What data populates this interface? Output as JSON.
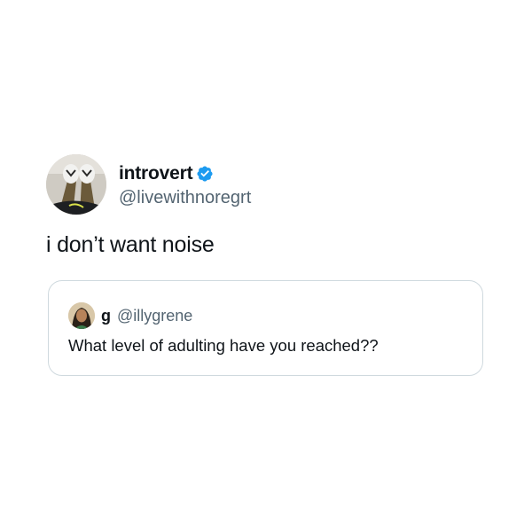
{
  "tweet": {
    "author": {
      "display_name": "introvert",
      "handle": "@livewithnoregrt",
      "verified": true,
      "avatar_icon": "avatar-photo-feet-icon"
    },
    "text": "i don’t want noise",
    "quoted_tweet": {
      "display_name": "g",
      "handle": "@illygrene",
      "avatar_icon": "avatar-photo-person-icon",
      "text": "What level of adulting have you reached??"
    }
  },
  "colors": {
    "background": "#ffffff",
    "text_primary": "#0f1419",
    "text_secondary": "#536471",
    "verified_badge": "#1d9bf0",
    "card_border": "#cfd9de"
  }
}
